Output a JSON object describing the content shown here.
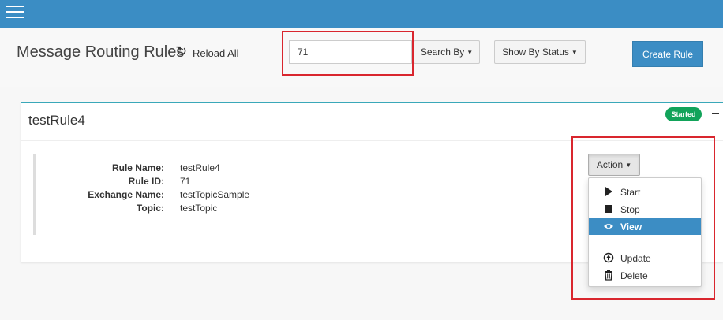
{
  "header": {
    "title": "Message Routing Rules",
    "reload_label": "Reload All",
    "search": {
      "value": "71",
      "placeholder": ""
    },
    "search_by_label": "Search By",
    "show_by_status_label": "Show By Status",
    "create_rule_label": "Create Rule"
  },
  "rule": {
    "name": "testRule4",
    "status": "Started",
    "status_color": "#12a35a",
    "details": [
      {
        "label": "Rule Name:",
        "value": "testRule4"
      },
      {
        "label": "Rule ID:",
        "value": "71"
      },
      {
        "label": "Exchange Name:",
        "value": "testTopicSample"
      },
      {
        "label": "Topic:",
        "value": "testTopic"
      }
    ]
  },
  "action_menu": {
    "button_label": "Action",
    "items": [
      {
        "label": "Start",
        "icon": "play-icon"
      },
      {
        "label": "Stop",
        "icon": "stop-icon"
      },
      {
        "label": "View",
        "icon": "eye-icon",
        "active": true
      },
      {
        "label": "Update",
        "icon": "arrow-up-circle-icon"
      },
      {
        "label": "Delete",
        "icon": "trash-icon"
      }
    ]
  },
  "colors": {
    "topbar": "#3b8dc4",
    "primary": "#3c8dc4",
    "highlight": "#d9262e"
  }
}
